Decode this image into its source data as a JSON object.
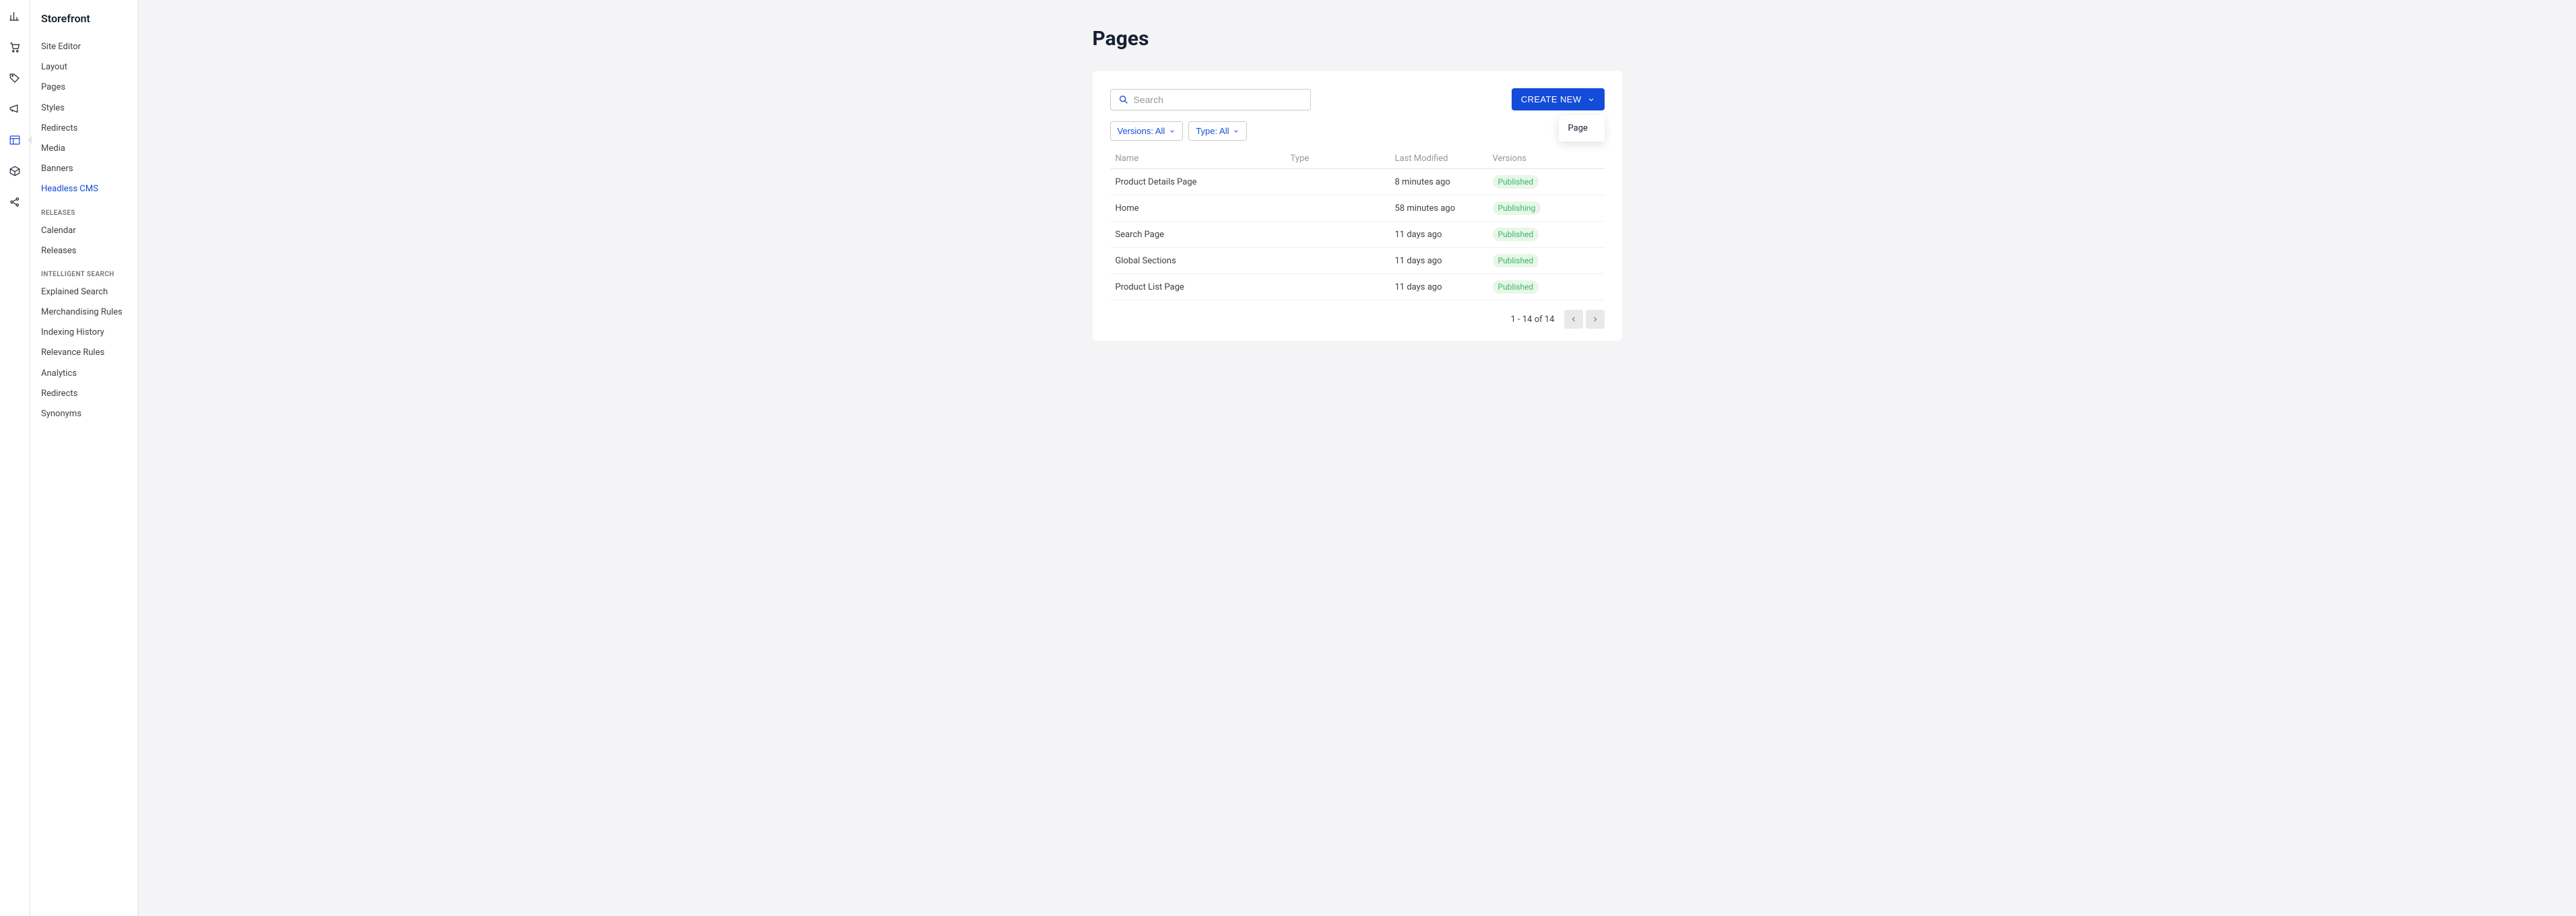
{
  "sidebar": {
    "title": "Storefront",
    "main_items": [
      {
        "label": "Site Editor"
      },
      {
        "label": "Layout"
      },
      {
        "label": "Pages"
      },
      {
        "label": "Styles"
      },
      {
        "label": "Redirects"
      },
      {
        "label": "Media"
      },
      {
        "label": "Banners"
      },
      {
        "label": "Headless CMS",
        "active": true
      }
    ],
    "section_releases": "RELEASES",
    "releases_items": [
      {
        "label": "Calendar"
      },
      {
        "label": "Releases"
      }
    ],
    "section_search": "INTELLIGENT SEARCH",
    "search_items": [
      {
        "label": "Explained Search"
      },
      {
        "label": "Merchandising Rules"
      },
      {
        "label": "Indexing History"
      },
      {
        "label": "Relevance Rules"
      },
      {
        "label": "Analytics"
      },
      {
        "label": "Redirects"
      },
      {
        "label": "Synonyms"
      }
    ]
  },
  "page": {
    "title": "Pages",
    "search_placeholder": "Search",
    "create_label": "CREATE NEW",
    "dropdown_page": "Page",
    "filter_versions": "Versions: All",
    "filter_type": "Type: All"
  },
  "table": {
    "headers": {
      "name": "Name",
      "type": "Type",
      "modified": "Last Modified",
      "versions": "Versions"
    },
    "rows": [
      {
        "name": "Product Details Page",
        "type": "",
        "modified": "8 minutes ago",
        "version": "Published"
      },
      {
        "name": "Home",
        "type": "",
        "modified": "58 minutes ago",
        "version": "Publishing"
      },
      {
        "name": "Search Page",
        "type": "",
        "modified": "11 days ago",
        "version": "Published"
      },
      {
        "name": "Global Sections",
        "type": "",
        "modified": "11 days ago",
        "version": "Published"
      },
      {
        "name": "Product List Page",
        "type": "",
        "modified": "11 days ago",
        "version": "Published"
      }
    ]
  },
  "pager": {
    "text": "1 - 14 of 14"
  }
}
